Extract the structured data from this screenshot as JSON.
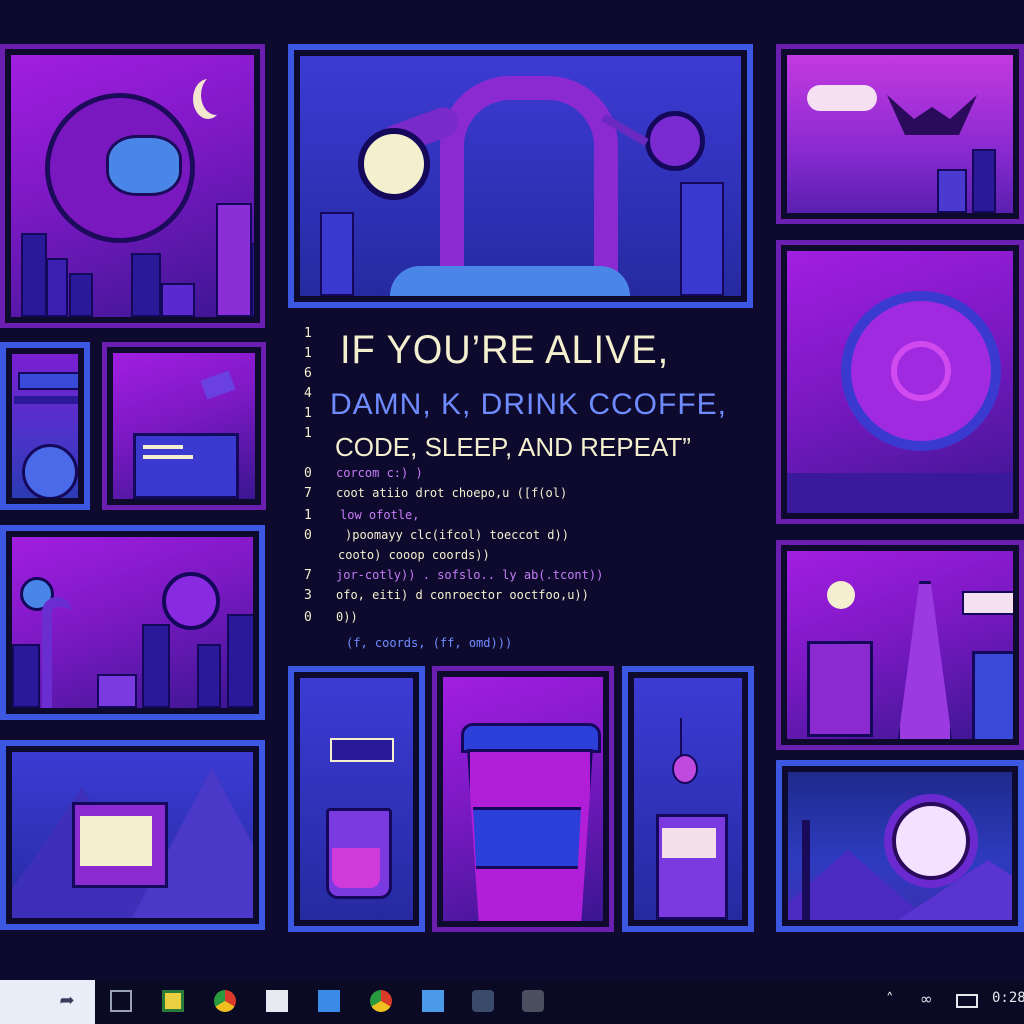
{
  "quote": {
    "line1": "IF YOU’RE ALIVE,",
    "line2": "DAMN, K, DRINK CCOFFE,",
    "line3": "CODE, SLEEP, AND REPEAT”"
  },
  "line_numbers": [
    "1",
    "1",
    "6",
    "4",
    "1",
    "1",
    "0",
    "7",
    "1",
    "0",
    "7",
    "3",
    "0"
  ],
  "code_lines": [
    {
      "text": "corcom c:) )",
      "color": "#c67cf5"
    },
    {
      "text": "coot atiio drot choepo,u ([f(ol)",
      "color": "#f4efcf"
    },
    {
      "text": "low ofotle,",
      "color": "#c67cf5"
    },
    {
      "text": ")poomayy clc(ifcol)  toeccot d))",
      "color": "#f4efcf"
    },
    {
      "text": "cooto) cooop coords))",
      "color": "#f4efcf"
    },
    {
      "text": "jor-cotly)) .  sofslo.. ly ab(.tcont))",
      "color": "#c67cf5"
    },
    {
      "text": "ofo, eiti) d  conroector ooctfoo,u))",
      "color": "#f4efcf"
    },
    {
      "text": "0))",
      "color": "#f4efcf"
    },
    {
      "text": "(f, coords,  (ff, omd)))",
      "color": "#6f8cff"
    }
  ],
  "taskbar": {
    "icons": [
      "back-arrow-icon",
      "task-view-icon",
      "file-explorer-icon",
      "chrome-icon",
      "app-icon",
      "store-icon",
      "chrome-icon",
      "mail-icon",
      "edge-icon",
      "settings-icon"
    ],
    "clock": "0:28",
    "tray_icons": [
      "chevron-up-icon",
      "wifi-icon",
      "keyboard-icon"
    ]
  },
  "colors": {
    "background": "#0d0a2e",
    "purple": "#8b1fd6",
    "blue": "#3c57e0",
    "cream": "#f4efcf"
  }
}
